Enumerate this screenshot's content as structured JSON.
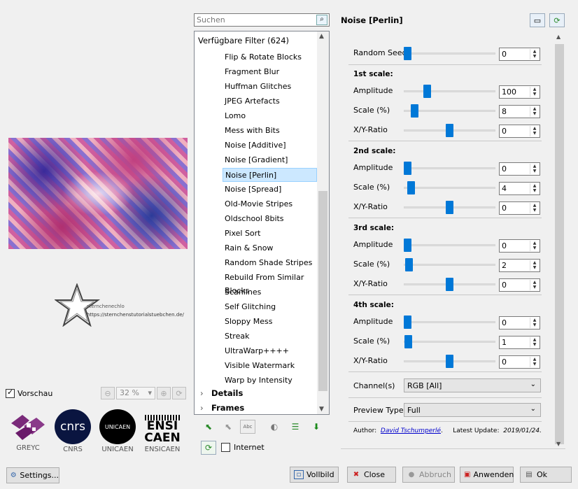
{
  "preview": {
    "watermark_label": "sternchenechlo",
    "watermark_url": "https://sternchenstutorialstuebchen.de/",
    "checkbox_label": "Vorschau",
    "zoom": "32 %"
  },
  "logos": [
    {
      "name": "GREYC",
      "caption": "GREYC"
    },
    {
      "name": "CNRS",
      "caption": "CNRS",
      "mark": "cnrs"
    },
    {
      "name": "UNICAEN",
      "caption": "UNICAEN",
      "mark": "UNICAEN"
    },
    {
      "name": "ENSICAEN",
      "caption": "ENSICAEN",
      "mark1": "ENSI",
      "mark2": "CAEN"
    }
  ],
  "settings_label": "Settings...",
  "search": {
    "placeholder": "Suchen"
  },
  "filters": {
    "root": "Verfügbare Filter (624)",
    "items": [
      "Flip & Rotate Blocks",
      "Fragment Blur",
      "Huffman Glitches",
      "JPEG Artefacts",
      "Lomo",
      "Mess with Bits",
      "Noise [Additive]",
      "Noise [Gradient]",
      "Noise [Perlin]",
      "Noise [Spread]",
      "Old-Movie Stripes",
      "Oldschool 8bits",
      "Pixel Sort",
      "Rain & Snow",
      "Random Shade Stripes",
      "Rebuild From Similar Blocks",
      "Scanlines",
      "Self Glitching",
      "Sloppy Mess",
      "Streak",
      "UltraWarp++++",
      "Visible Watermark",
      "Warp by Intensity"
    ],
    "selected": "Noise [Perlin]",
    "categories": [
      "Details",
      "Frames"
    ]
  },
  "internet_label": "Internet",
  "filter_title": "Noise [Perlin]",
  "params": {
    "random_seed": {
      "label": "Random Seed",
      "value": "0"
    },
    "sections": [
      {
        "title": "1st scale:",
        "amplitude": "100",
        "scale": "8",
        "ratio": "0"
      },
      {
        "title": "2nd scale:",
        "amplitude": "0",
        "scale": "4",
        "ratio": "0"
      },
      {
        "title": "3rd scale:",
        "amplitude": "0",
        "scale": "2",
        "ratio": "0"
      },
      {
        "title": "4th scale:",
        "amplitude": "0",
        "scale": "1",
        "ratio": "0"
      }
    ],
    "amplitude_label": "Amplitude",
    "scale_label": "Scale (%)",
    "ratio_label": "X/Y-Ratio",
    "channels": {
      "label": "Channel(s)",
      "value": "RGB [All]"
    },
    "preview_type": {
      "label": "Preview Type",
      "value": "Full"
    },
    "author_prefix": "Author:",
    "author": "David Tschumperlé",
    "author_suffix": ".",
    "update_prefix": "Latest Update:",
    "update": "2019/01/24"
  },
  "buttons": {
    "fullscreen": "Vollbild",
    "close": "Close",
    "cancel": "Abbruch",
    "apply": "Anwenden",
    "ok": "Ok"
  },
  "colors": {
    "accent": "#0078d7",
    "selection": "#cce8ff"
  }
}
